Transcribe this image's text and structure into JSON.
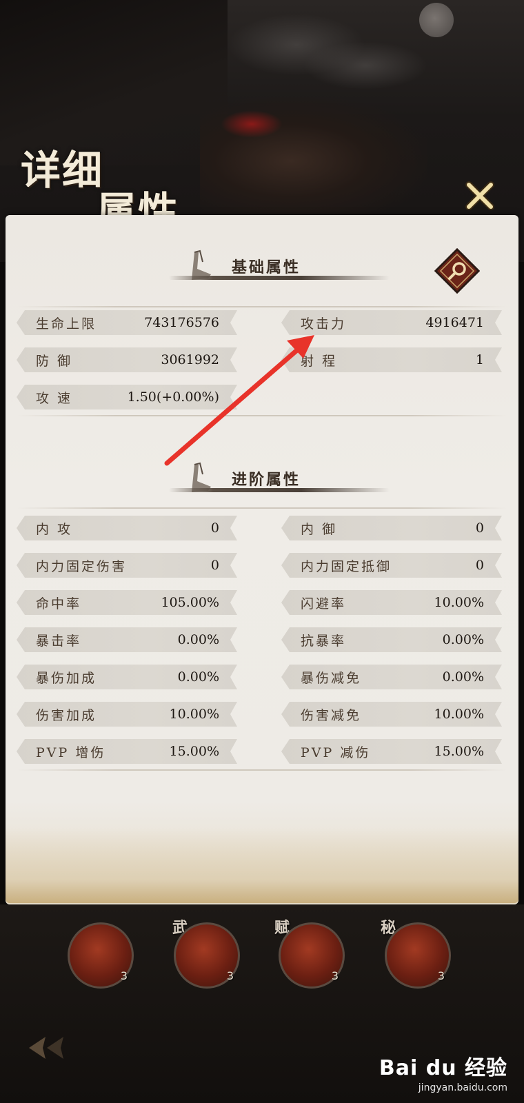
{
  "header": {
    "title_line1": "详细",
    "title_line2": "属性"
  },
  "basic": {
    "title": "基础属性",
    "stats": [
      {
        "name": "生命上限",
        "value": "743176576"
      },
      {
        "name": "攻击力",
        "value": "4916471"
      },
      {
        "name": "防  御",
        "value": "3061992"
      },
      {
        "name": "射  程",
        "value": "1"
      },
      {
        "name": "攻  速",
        "value": "1.50(+0.00%)"
      }
    ]
  },
  "advanced": {
    "title": "进阶属性",
    "stats": [
      {
        "name": "内  攻",
        "value": "0"
      },
      {
        "name": "内  御",
        "value": "0"
      },
      {
        "name": "内力固定伤害",
        "value": "0"
      },
      {
        "name": "内力固定抵御",
        "value": "0"
      },
      {
        "name": "命中率",
        "value": "105.00%"
      },
      {
        "name": "闪避率",
        "value": "10.00%"
      },
      {
        "name": "暴击率",
        "value": "0.00%"
      },
      {
        "name": "抗暴率",
        "value": "0.00%"
      },
      {
        "name": "暴伤加成",
        "value": "0.00%"
      },
      {
        "name": "暴伤减免",
        "value": "0.00%"
      },
      {
        "name": "伤害加成",
        "value": "10.00%"
      },
      {
        "name": "伤害减免",
        "value": "10.00%"
      },
      {
        "name": "PVP 增伤",
        "value": "15.00%"
      },
      {
        "name": "PVP 减伤",
        "value": "15.00%"
      }
    ]
  },
  "skills": [
    {
      "tag": "",
      "level": "3"
    },
    {
      "tag": "武",
      "level": "3"
    },
    {
      "tag": "赋",
      "level": "3"
    },
    {
      "tag": "秘",
      "level": "3"
    }
  ],
  "watermark": {
    "brand": "Bai du 经验",
    "url": "jingyan.baidu.com"
  },
  "colors": {
    "panel_bg": "#eeebe6",
    "stat_pill": "#d9d5ce",
    "annotation_arrow": "#e8332a",
    "search_button": "#7a2a1c"
  },
  "icons": {
    "close": "close-icon",
    "search": "search-icon",
    "back": "back-arrow-icon",
    "section": "sword-icon"
  }
}
